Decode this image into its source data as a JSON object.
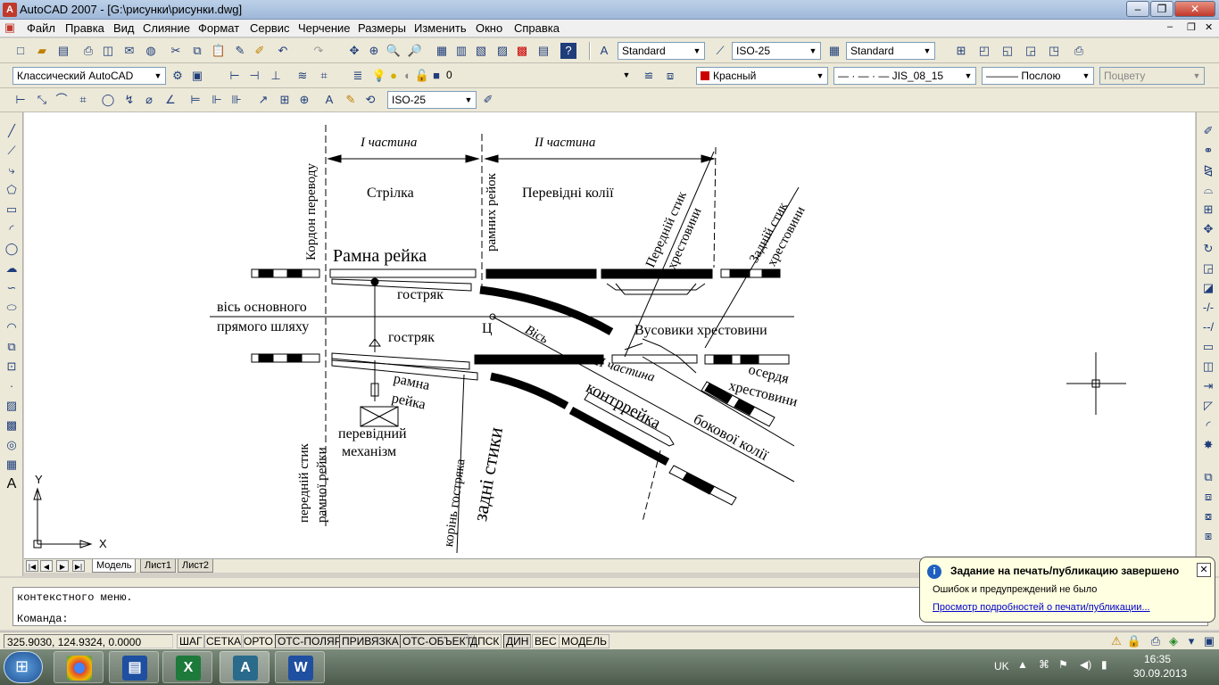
{
  "window": {
    "title": "AutoCAD 2007 - [G:\\рисунки\\рисунки.dwg]",
    "app_icon": "A"
  },
  "menu": [
    "Файл",
    "Правка",
    "Вид",
    "Слияние",
    "Формат",
    "Сервис",
    "Черчение",
    "Размеры",
    "Изменить",
    "Окно",
    "Справка"
  ],
  "toolbars": {
    "text_style": "Standard",
    "dim_style": "ISO-25",
    "table_style": "Standard",
    "workspace": "Классический AutoCAD",
    "layer": "0",
    "color": "Красный",
    "color_hex": "#cc0000",
    "linetype": "JIS_08_15",
    "lineweight": "Послою",
    "plotstyle": "Поцвету",
    "dim_style2": "ISO-25"
  },
  "drawing": {
    "part1": "I  частина",
    "part2": "II  частина",
    "part3": "III  частина",
    "strilka": "Стрілка",
    "perevidni_kolii": "Перевідні колії",
    "kordon": "Кордон переводу",
    "ramnykh_reiok": "рамних рейок",
    "ramna_reika": "Рамна рейка",
    "hostriak1": "гостряк",
    "hostriak2": "гостряк",
    "vis_osn1": "вісь основного",
    "vis_osn2": "прямого шляху",
    "ts": "Ц",
    "vis": "Вісь",
    "vusovyky": "Вусовики хрестовини",
    "ramna2a": "рамна",
    "ramna2b": "рейка",
    "perevidnyi1": "перевідний",
    "perevidnyi2": "механізм",
    "peredni_styk1": "передній стик",
    "peredni_styk2": "рамної рейки",
    "korin": "корінь гостряка",
    "zadni_styky": "задні стики",
    "kontrreika": "контррейка",
    "bokovoi": "бокової колії",
    "oserdia1": "осердя",
    "oserdia2": "хрестовини",
    "peredni_styk_hr1": "Передній стик",
    "peredni_styk_hr2": "хрестовини",
    "zadni_styk_hr1": "Задній стик",
    "zadni_styk_hr2": "хрестовини",
    "ucs_x": "X",
    "ucs_y": "Y"
  },
  "layout_tabs": [
    "Модель",
    "Лист1",
    "Лист2"
  ],
  "command": {
    "history": "контекстного меню.",
    "prompt": "Команда:"
  },
  "status": {
    "coords": "325.9030, 124.9324, 0.0000",
    "buttons": [
      "ШАГ",
      "СЕТКА",
      "ОРТО",
      "ОТС-ПОЛЯР",
      "ПРИВЯЗКА",
      "ОТС-ОБЪЕКТ",
      "ДПСК",
      "ДИН",
      "ВЕС",
      "МОДЕЛЬ"
    ]
  },
  "notification": {
    "title": "Задание на печать/публикацию завершено",
    "message": "Ошибок и предупреждений не было",
    "link": "Просмотр подробностей о печати/публикации..."
  },
  "taskbar": {
    "lang": "UK",
    "time": "16:35",
    "date": "30.09.2013"
  }
}
